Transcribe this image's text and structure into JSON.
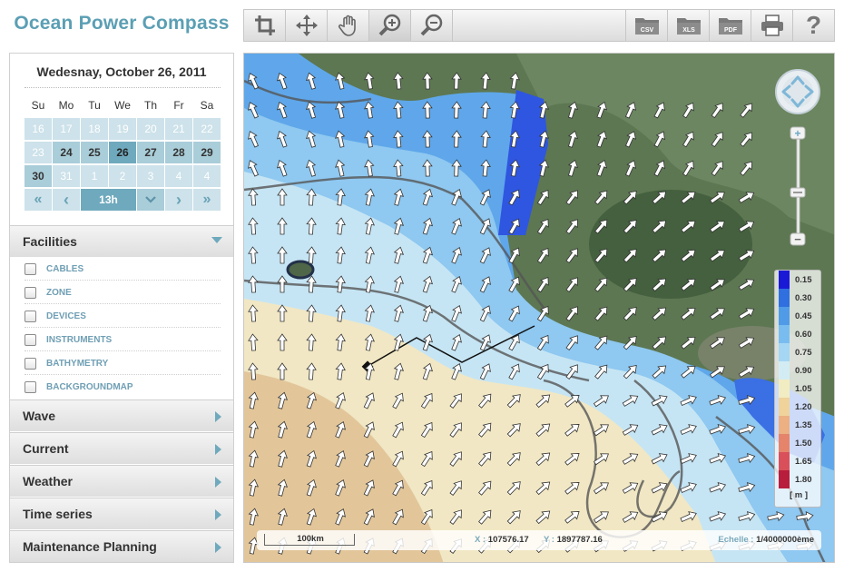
{
  "app": {
    "title": "Ocean Power Compass"
  },
  "toolbar": {
    "tools": [
      {
        "name": "crop-tool",
        "icon": "crop-icon"
      },
      {
        "name": "pan-tool",
        "icon": "move-arrows-icon"
      },
      {
        "name": "hand-tool",
        "icon": "hand-icon"
      },
      {
        "name": "zoom-in-tool",
        "icon": "zoom-in-icon",
        "active": true
      },
      {
        "name": "zoom-out-tool",
        "icon": "zoom-out-icon"
      }
    ],
    "exports": {
      "csv": "CSV",
      "xls": "XLS",
      "pdf": "PDF"
    },
    "help": "?"
  },
  "calendar": {
    "date": "Wedesnay, October 26, 2011",
    "weekdays": [
      "Su",
      "Mo",
      "Tu",
      "We",
      "Th",
      "Fr",
      "Sa"
    ],
    "weeks": [
      [
        "16",
        "17",
        "18",
        "19",
        "20",
        "21",
        "22"
      ],
      [
        "23",
        "24",
        "25",
        "26",
        "27",
        "28",
        "29"
      ],
      [
        "30",
        "31",
        "1",
        "2",
        "3",
        "4"
      ]
    ],
    "hour": "13h",
    "nav": {
      "first": "«",
      "prev": "‹",
      "next": "›",
      "last": "»"
    }
  },
  "sidebar": {
    "facilities": {
      "label": "Facilities",
      "items": [
        "CABLES",
        "ZONE",
        "DEVICES",
        "INSTRUMENTS",
        "BATHYMETRY",
        "BACKGROUNDMAP"
      ]
    },
    "sections": [
      "Wave",
      "Current",
      "Weather",
      "Time series",
      "Maintenance Planning"
    ]
  },
  "map": {
    "zoom": {
      "plus": "+",
      "minus": "−"
    },
    "legend": {
      "values": [
        "0.15",
        "0.30",
        "0.45",
        "0.60",
        "0.75",
        "0.90",
        "1.05",
        "1.20",
        "1.35",
        "1.50",
        "1.65",
        "1.80"
      ],
      "colors": [
        "#1a1ad6",
        "#2f6fe0",
        "#4f9be8",
        "#79bdf0",
        "#a5d6f4",
        "#d3ecf3",
        "#f2ecc2",
        "#efd39a",
        "#ecb083",
        "#e5836b",
        "#d9505a",
        "#b81d3b"
      ],
      "unit": "[ m ]"
    },
    "status": {
      "scale": "100km",
      "x_label": "X :",
      "x_value": "107576.17",
      "y_label": "Y :",
      "y_value": "1897787.16",
      "echelle_label": "Echelle :",
      "echelle_value": "1/4000000ème"
    }
  }
}
